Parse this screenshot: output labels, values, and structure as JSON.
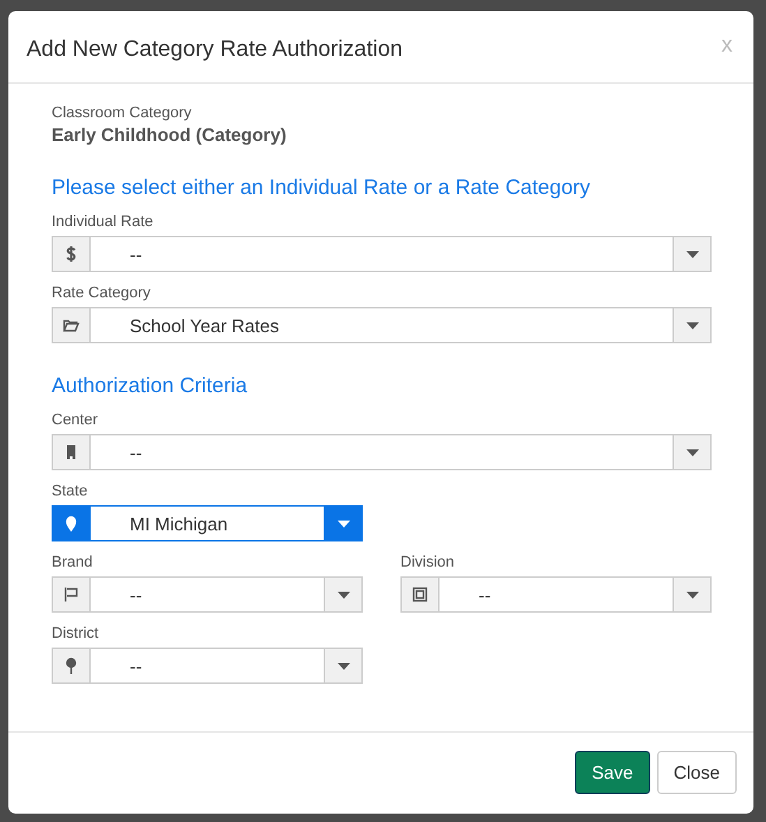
{
  "dialog": {
    "title": "Add New Category Rate Authorization",
    "close": "x"
  },
  "classroom": {
    "label": "Classroom Category",
    "value": "Early Childhood (Category)"
  },
  "rate_section": {
    "heading": "Please select either an Individual Rate or a Rate Category",
    "individual_rate": {
      "label": "Individual Rate",
      "value": "--",
      "focused": false
    },
    "rate_category": {
      "label": "Rate Category",
      "value": "School Year Rates",
      "focused": false
    }
  },
  "criteria_section": {
    "heading": "Authorization Criteria",
    "center": {
      "label": "Center",
      "value": "--",
      "focused": false
    },
    "state": {
      "label": "State",
      "value": "MI Michigan",
      "focused": true
    },
    "brand": {
      "label": "Brand",
      "value": "--",
      "focused": false
    },
    "division": {
      "label": "Division",
      "value": "--",
      "focused": false
    },
    "district": {
      "label": "District",
      "value": "--",
      "focused": false
    }
  },
  "buttons": [
    {
      "label": "Save",
      "kind": "primary"
    },
    {
      "label": "Close",
      "kind": "default"
    }
  ]
}
